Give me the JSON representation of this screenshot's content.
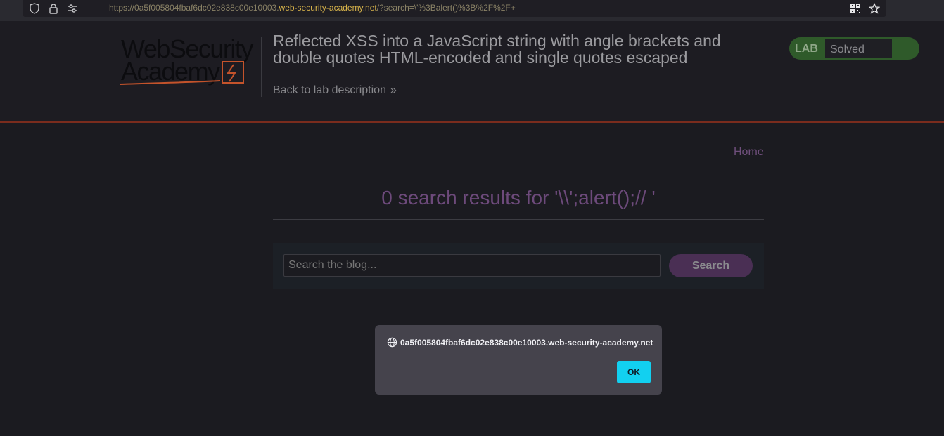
{
  "browser": {
    "url_prefix": "https://0a5f005804fbaf6dc02e838c00e10003.",
    "url_host": "web-security-academy.net",
    "url_suffix": "/?search=\\'%3Balert()%3B%2F%2F+",
    "icons": [
      "shield-icon",
      "lock-icon",
      "site-settings-icon",
      "qr-code-icon",
      "bookmark-star-icon"
    ]
  },
  "header": {
    "logo_line1": "WebSecurity",
    "logo_line2": "Academy",
    "title": "Reflected XSS into a JavaScript string with angle brackets and double quotes HTML-encoded and single quotes escaped",
    "back_link": "Back to lab description",
    "lab_label": "LAB",
    "lab_status": "Solved"
  },
  "nav": {
    "home": "Home"
  },
  "main": {
    "results_heading": "0 search results for '\\\\';alert();// '",
    "search_placeholder": "Search the blog...",
    "search_button": "Search"
  },
  "dialog": {
    "origin": "0a5f005804fbaf6dc02e838c00e10003.web-security-academy.net",
    "ok_label": "OK"
  },
  "colors": {
    "accent_purple": "#6d4a7b",
    "lab_green": "#2f5a2a",
    "ok_cyan": "#12d0f0",
    "header_rule": "#7a2c1d"
  }
}
